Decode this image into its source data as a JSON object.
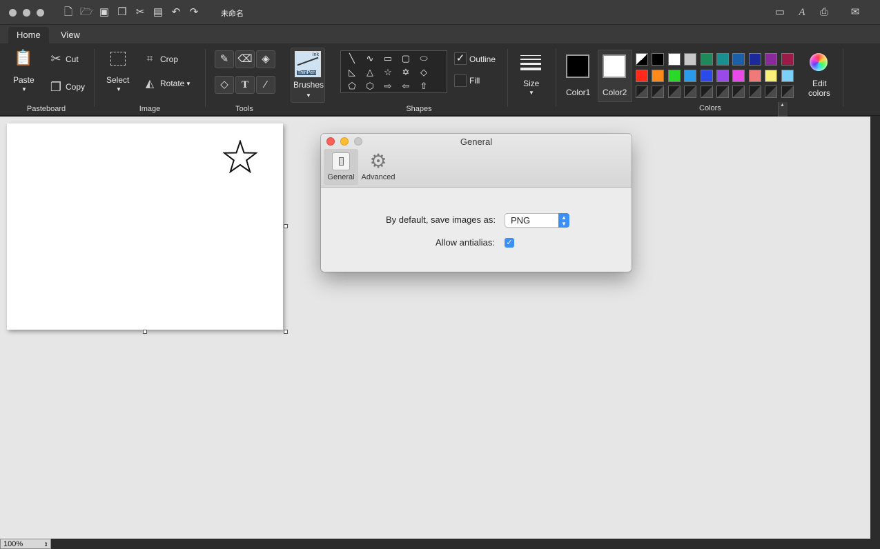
{
  "window": {
    "title": "未命名"
  },
  "tabs": [
    {
      "label": "Home"
    },
    {
      "label": "View"
    }
  ],
  "ribbon": {
    "pasteboard": {
      "paste_label": "Paste",
      "cut_label": "Cut",
      "copy_label": "Copy",
      "group_label": "Pasteboard"
    },
    "image": {
      "select_label": "Select",
      "crop_label": "Crop",
      "rotate_label": "Rotate",
      "group_label": "Image"
    },
    "tools": {
      "group_label": "Tools"
    },
    "brushes": {
      "label": "Brushes",
      "thumb_top": "Ink",
      "thumb_bottom": "ThinPen"
    },
    "shapes": {
      "group_label": "Shapes",
      "outline_label": "Outline",
      "fill_label": "Fill"
    },
    "size": {
      "label": "Size"
    },
    "colors": {
      "color1_label": "Color1",
      "color2_label": "Color2",
      "edit_label_line1": "Edit",
      "edit_label_line2": "colors",
      "group_label": "Colors",
      "color1": "#000000",
      "color2": "#ffffff",
      "row1": [
        "#000000",
        "#ffffff",
        "#c8c8c8",
        "#1e8a5a",
        "#1a8f8f",
        "#1a5fa8",
        "#1a2a9a",
        "#8a2a9a",
        "#9a1a4a"
      ],
      "row2": [
        "#ff2a1a",
        "#ff8a1a",
        "#2ad82a",
        "#2a9aea",
        "#2a4aea",
        "#9a4aea",
        "#ea4aea",
        "#f07a7a",
        "#f7f07a",
        "#7ad0f7"
      ]
    }
  },
  "status": {
    "zoom": "100%"
  },
  "dialog": {
    "title": "General",
    "tabs": [
      {
        "label": "General"
      },
      {
        "label": "Advanced"
      }
    ],
    "save_label": "By default, save images as:",
    "save_format": "PNG",
    "antialias_label": "Allow antialias:",
    "antialias_checked": true
  }
}
